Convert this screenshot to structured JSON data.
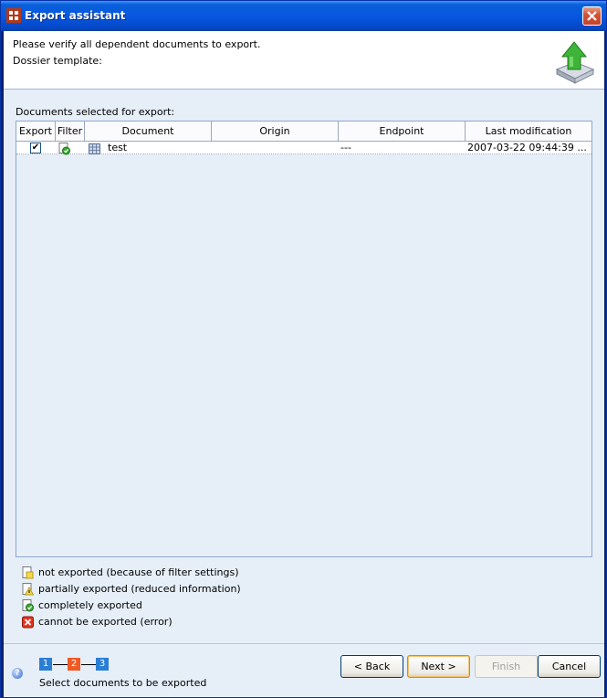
{
  "window": {
    "title": "Export assistant"
  },
  "header": {
    "line1": "Please verify all dependent documents to export.",
    "line2": "Dossier template:"
  },
  "table": {
    "section_label": "Documents selected for export:",
    "columns": [
      "Export",
      "Filter",
      "Document",
      "Origin",
      "Endpoint",
      "Last modification"
    ],
    "rows": [
      {
        "export": "✔",
        "filter_icon": "completely-exported-icon",
        "document": "test",
        "origin": "",
        "endpoint": "---",
        "last_modification": "2007-03-22 09:44:39 ..."
      }
    ]
  },
  "legend": [
    {
      "icon": "not-exported-icon",
      "label": "not exported (because of filter settings)"
    },
    {
      "icon": "partially-exported-icon",
      "label": "partially exported (reduced information)"
    },
    {
      "icon": "completely-exported-icon",
      "label": "completely exported"
    },
    {
      "icon": "error-icon",
      "label": "cannot be exported (error)"
    }
  ],
  "wizard": {
    "steps": [
      "1",
      "2",
      "3"
    ],
    "current_step": 2,
    "caption": "Select documents to be exported",
    "colors": {
      "done": "#2a7fd4",
      "current": "#f05a24",
      "todo": "#2a7fd4"
    }
  },
  "buttons": {
    "back": "< Back",
    "next": "Next >",
    "finish": "Finish",
    "cancel": "Cancel"
  }
}
